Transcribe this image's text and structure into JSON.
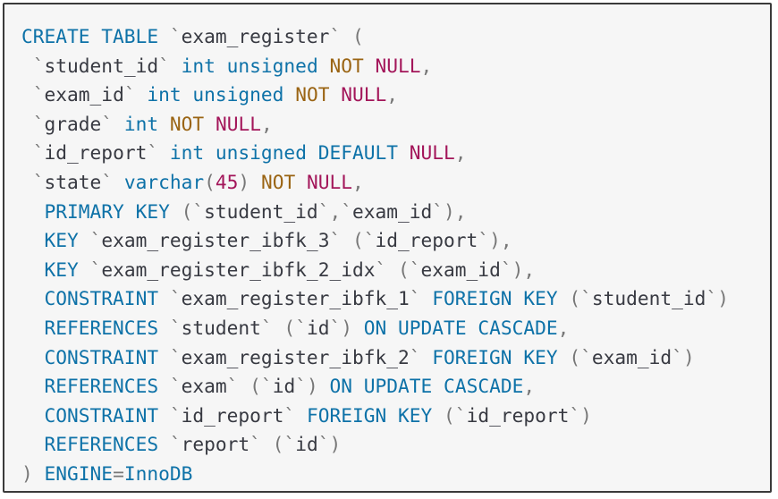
{
  "code": {
    "language": "sql",
    "lines": [
      [
        {
          "t": "CREATE TABLE",
          "c": "kw"
        },
        {
          "t": " ",
          "c": "idn"
        },
        {
          "t": "`",
          "c": "pun"
        },
        {
          "t": "exam_register",
          "c": "idn"
        },
        {
          "t": "`",
          "c": "pun"
        },
        {
          "t": " (",
          "c": "pun"
        }
      ],
      [
        {
          "t": " ",
          "c": "idn"
        },
        {
          "t": "`",
          "c": "pun"
        },
        {
          "t": "student_id",
          "c": "idn"
        },
        {
          "t": "`",
          "c": "pun"
        },
        {
          "t": " ",
          "c": "idn"
        },
        {
          "t": "int unsigned",
          "c": "kw"
        },
        {
          "t": " ",
          "c": "idn"
        },
        {
          "t": "NOT",
          "c": "nn"
        },
        {
          "t": " ",
          "c": "idn"
        },
        {
          "t": "NULL",
          "c": "nul"
        },
        {
          "t": ",",
          "c": "pun"
        }
      ],
      [
        {
          "t": " ",
          "c": "idn"
        },
        {
          "t": "`",
          "c": "pun"
        },
        {
          "t": "exam_id",
          "c": "idn"
        },
        {
          "t": "`",
          "c": "pun"
        },
        {
          "t": " ",
          "c": "idn"
        },
        {
          "t": "int unsigned",
          "c": "kw"
        },
        {
          "t": " ",
          "c": "idn"
        },
        {
          "t": "NOT",
          "c": "nn"
        },
        {
          "t": " ",
          "c": "idn"
        },
        {
          "t": "NULL",
          "c": "nul"
        },
        {
          "t": ",",
          "c": "pun"
        }
      ],
      [
        {
          "t": " ",
          "c": "idn"
        },
        {
          "t": "`",
          "c": "pun"
        },
        {
          "t": "grade",
          "c": "idn"
        },
        {
          "t": "`",
          "c": "pun"
        },
        {
          "t": " ",
          "c": "idn"
        },
        {
          "t": "int",
          "c": "kw"
        },
        {
          "t": " ",
          "c": "idn"
        },
        {
          "t": "NOT",
          "c": "nn"
        },
        {
          "t": " ",
          "c": "idn"
        },
        {
          "t": "NULL",
          "c": "nul"
        },
        {
          "t": ",",
          "c": "pun"
        }
      ],
      [
        {
          "t": " ",
          "c": "idn"
        },
        {
          "t": "`",
          "c": "pun"
        },
        {
          "t": "id_report",
          "c": "idn"
        },
        {
          "t": "`",
          "c": "pun"
        },
        {
          "t": " ",
          "c": "idn"
        },
        {
          "t": "int unsigned DEFAULT",
          "c": "kw"
        },
        {
          "t": " ",
          "c": "idn"
        },
        {
          "t": "NULL",
          "c": "nul"
        },
        {
          "t": ",",
          "c": "pun"
        }
      ],
      [
        {
          "t": " ",
          "c": "idn"
        },
        {
          "t": "`",
          "c": "pun"
        },
        {
          "t": "state",
          "c": "idn"
        },
        {
          "t": "`",
          "c": "pun"
        },
        {
          "t": " ",
          "c": "idn"
        },
        {
          "t": "varchar",
          "c": "kw"
        },
        {
          "t": "(",
          "c": "pun"
        },
        {
          "t": "45",
          "c": "num"
        },
        {
          "t": ")",
          "c": "pun"
        },
        {
          "t": " ",
          "c": "idn"
        },
        {
          "t": "NOT",
          "c": "nn"
        },
        {
          "t": " ",
          "c": "idn"
        },
        {
          "t": "NULL",
          "c": "nul"
        },
        {
          "t": ",",
          "c": "pun"
        }
      ],
      [
        {
          "t": "  ",
          "c": "idn"
        },
        {
          "t": "PRIMARY KEY",
          "c": "kw"
        },
        {
          "t": " (",
          "c": "pun"
        },
        {
          "t": "`",
          "c": "pun"
        },
        {
          "t": "student_id",
          "c": "idn"
        },
        {
          "t": "`,`",
          "c": "pun"
        },
        {
          "t": "exam_id",
          "c": "idn"
        },
        {
          "t": "`",
          "c": "pun"
        },
        {
          "t": "),",
          "c": "pun"
        }
      ],
      [
        {
          "t": "  ",
          "c": "idn"
        },
        {
          "t": "KEY",
          "c": "kw"
        },
        {
          "t": " ",
          "c": "idn"
        },
        {
          "t": "`",
          "c": "pun"
        },
        {
          "t": "exam_register_ibfk_3",
          "c": "idn"
        },
        {
          "t": "`",
          "c": "pun"
        },
        {
          "t": " (",
          "c": "pun"
        },
        {
          "t": "`",
          "c": "pun"
        },
        {
          "t": "id_report",
          "c": "idn"
        },
        {
          "t": "`",
          "c": "pun"
        },
        {
          "t": "),",
          "c": "pun"
        }
      ],
      [
        {
          "t": "  ",
          "c": "idn"
        },
        {
          "t": "KEY",
          "c": "kw"
        },
        {
          "t": " ",
          "c": "idn"
        },
        {
          "t": "`",
          "c": "pun"
        },
        {
          "t": "exam_register_ibfk_2_idx",
          "c": "idn"
        },
        {
          "t": "`",
          "c": "pun"
        },
        {
          "t": " (",
          "c": "pun"
        },
        {
          "t": "`",
          "c": "pun"
        },
        {
          "t": "exam_id",
          "c": "idn"
        },
        {
          "t": "`",
          "c": "pun"
        },
        {
          "t": "),",
          "c": "pun"
        }
      ],
      [
        {
          "t": "  ",
          "c": "idn"
        },
        {
          "t": "CONSTRAINT",
          "c": "kw"
        },
        {
          "t": " ",
          "c": "idn"
        },
        {
          "t": "`",
          "c": "pun"
        },
        {
          "t": "exam_register_ibfk_1",
          "c": "idn"
        },
        {
          "t": "`",
          "c": "pun"
        },
        {
          "t": " ",
          "c": "idn"
        },
        {
          "t": "FOREIGN KEY",
          "c": "kw"
        },
        {
          "t": " (",
          "c": "pun"
        },
        {
          "t": "`",
          "c": "pun"
        },
        {
          "t": "student_id",
          "c": "idn"
        },
        {
          "t": "`",
          "c": "pun"
        },
        {
          "t": ")",
          "c": "pun"
        }
      ],
      [
        {
          "t": "  ",
          "c": "idn"
        },
        {
          "t": "REFERENCES",
          "c": "kw"
        },
        {
          "t": " ",
          "c": "idn"
        },
        {
          "t": "`",
          "c": "pun"
        },
        {
          "t": "student",
          "c": "idn"
        },
        {
          "t": "`",
          "c": "pun"
        },
        {
          "t": " (",
          "c": "pun"
        },
        {
          "t": "`",
          "c": "pun"
        },
        {
          "t": "id",
          "c": "idn"
        },
        {
          "t": "`",
          "c": "pun"
        },
        {
          "t": ")",
          "c": "pun"
        },
        {
          "t": " ",
          "c": "idn"
        },
        {
          "t": "ON UPDATE CASCADE",
          "c": "kw"
        },
        {
          "t": ",",
          "c": "pun"
        }
      ],
      [
        {
          "t": "  ",
          "c": "idn"
        },
        {
          "t": "CONSTRAINT",
          "c": "kw"
        },
        {
          "t": " ",
          "c": "idn"
        },
        {
          "t": "`",
          "c": "pun"
        },
        {
          "t": "exam_register_ibfk_2",
          "c": "idn"
        },
        {
          "t": "`",
          "c": "pun"
        },
        {
          "t": " ",
          "c": "idn"
        },
        {
          "t": "FOREIGN KEY",
          "c": "kw"
        },
        {
          "t": " (",
          "c": "pun"
        },
        {
          "t": "`",
          "c": "pun"
        },
        {
          "t": "exam_id",
          "c": "idn"
        },
        {
          "t": "`",
          "c": "pun"
        },
        {
          "t": ")",
          "c": "pun"
        }
      ],
      [
        {
          "t": "  ",
          "c": "idn"
        },
        {
          "t": "REFERENCES",
          "c": "kw"
        },
        {
          "t": " ",
          "c": "idn"
        },
        {
          "t": "`",
          "c": "pun"
        },
        {
          "t": "exam",
          "c": "idn"
        },
        {
          "t": "`",
          "c": "pun"
        },
        {
          "t": " (",
          "c": "pun"
        },
        {
          "t": "`",
          "c": "pun"
        },
        {
          "t": "id",
          "c": "idn"
        },
        {
          "t": "`",
          "c": "pun"
        },
        {
          "t": ")",
          "c": "pun"
        },
        {
          "t": " ",
          "c": "idn"
        },
        {
          "t": "ON UPDATE CASCADE",
          "c": "kw"
        },
        {
          "t": ",",
          "c": "pun"
        }
      ],
      [
        {
          "t": "  ",
          "c": "idn"
        },
        {
          "t": "CONSTRAINT",
          "c": "kw"
        },
        {
          "t": " ",
          "c": "idn"
        },
        {
          "t": "`",
          "c": "pun"
        },
        {
          "t": "id_report",
          "c": "idn"
        },
        {
          "t": "`",
          "c": "pun"
        },
        {
          "t": " ",
          "c": "idn"
        },
        {
          "t": "FOREIGN KEY",
          "c": "kw"
        },
        {
          "t": " (",
          "c": "pun"
        },
        {
          "t": "`",
          "c": "pun"
        },
        {
          "t": "id_report",
          "c": "idn"
        },
        {
          "t": "`",
          "c": "pun"
        },
        {
          "t": ")",
          "c": "pun"
        }
      ],
      [
        {
          "t": "  ",
          "c": "idn"
        },
        {
          "t": "REFERENCES",
          "c": "kw"
        },
        {
          "t": " ",
          "c": "idn"
        },
        {
          "t": "`",
          "c": "pun"
        },
        {
          "t": "report",
          "c": "idn"
        },
        {
          "t": "`",
          "c": "pun"
        },
        {
          "t": " (",
          "c": "pun"
        },
        {
          "t": "`",
          "c": "pun"
        },
        {
          "t": "id",
          "c": "idn"
        },
        {
          "t": "`",
          "c": "pun"
        },
        {
          "t": ")",
          "c": "pun"
        }
      ],
      [
        {
          "t": ")",
          "c": "pun"
        },
        {
          "t": " ",
          "c": "idn"
        },
        {
          "t": "ENGINE",
          "c": "kw"
        },
        {
          "t": "=",
          "c": "pun"
        },
        {
          "t": "InnoDB",
          "c": "kw"
        }
      ]
    ]
  },
  "colors": {
    "keyword": "#0e72a8",
    "not": "#9a6413",
    "null_and_number": "#a3165a",
    "punctuation": "#777777",
    "identifier": "#383a42",
    "background": "#f6f6f6",
    "border": "#3a3a3a"
  }
}
